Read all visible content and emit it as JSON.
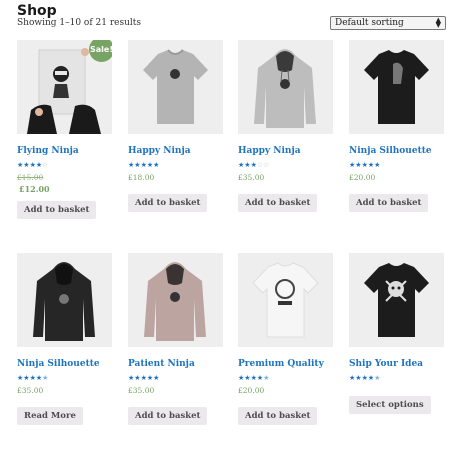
{
  "header": {
    "title": "Shop",
    "result_count": "Showing 1–10 of 21 results",
    "sort": {
      "selected": "Default sorting"
    }
  },
  "products": [
    {
      "name": "Flying Ninja",
      "rating": 4,
      "old_price": "£15.00",
      "price": "£12.00",
      "sale_badge": "Sale!",
      "button": "Add to basket",
      "image": "ninja-poster"
    },
    {
      "name": "Happy Ninja",
      "rating": 5,
      "price": "£18.00",
      "button": "Add to basket",
      "image": "grey-tshirt"
    },
    {
      "name": "Happy Ninja",
      "rating": 3,
      "price": "£35.00",
      "button": "Add to basket",
      "image": "grey-hoodie"
    },
    {
      "name": "Ninja Silhouette",
      "rating": 5,
      "price": "£20.00",
      "button": "Add to basket",
      "image": "black-tshirt"
    },
    {
      "name": "Ninja Silhouette",
      "rating": 4.5,
      "price": "£35.00",
      "button": "Read More",
      "image": "black-hoodie"
    },
    {
      "name": "Patient Ninja",
      "rating": 5,
      "price": "£35.00",
      "button": "Add to basket",
      "image": "pink-hoodie"
    },
    {
      "name": "Premium Quality",
      "rating": 4.5,
      "price": "£20.00",
      "button": "Add to basket",
      "image": "white-tshirt"
    },
    {
      "name": "Ship Your Idea",
      "rating": 4.5,
      "price": "",
      "button": "Select options",
      "image": "black-tshirt-skull"
    }
  ],
  "colors": {
    "link": "#1e73be",
    "price": "#77a464",
    "button_bg": "#ebe9eb",
    "sale": "#77a464"
  }
}
